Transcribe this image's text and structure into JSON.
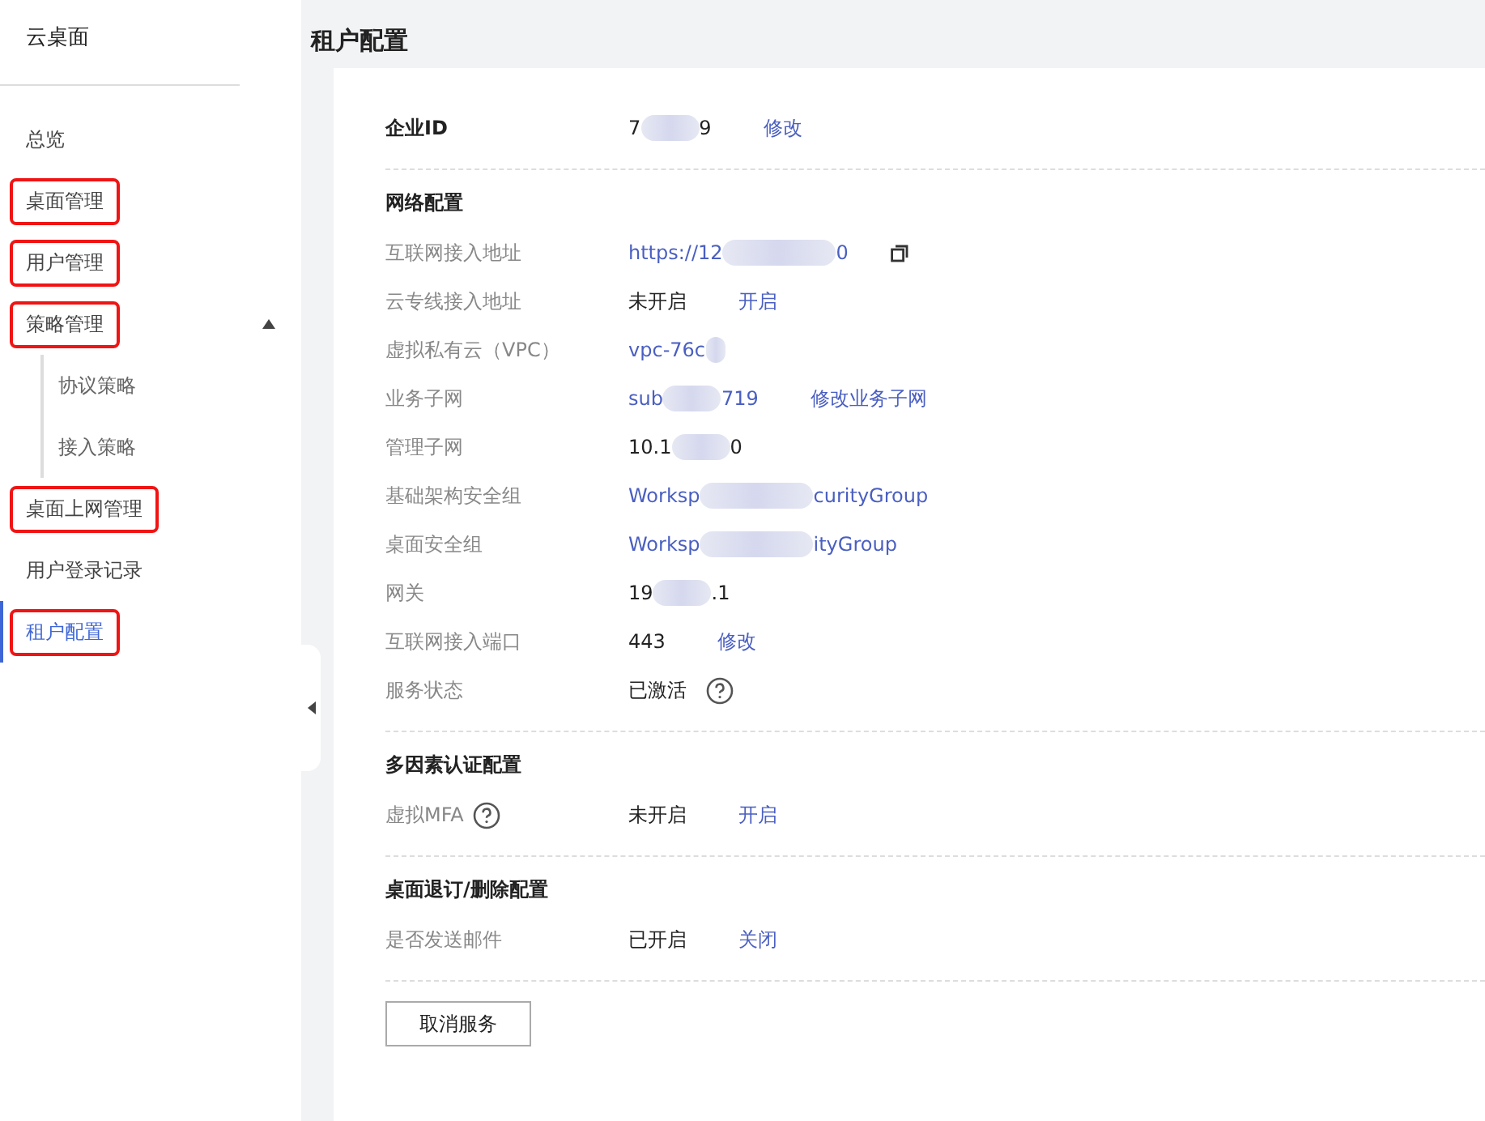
{
  "sidebar": {
    "title": "云桌面",
    "items": [
      {
        "label": "总览",
        "selected": false,
        "highlighted": false
      },
      {
        "label": "桌面管理",
        "selected": false,
        "highlighted": true
      },
      {
        "label": "用户管理",
        "selected": false,
        "highlighted": true
      },
      {
        "label": "策略管理",
        "selected": false,
        "highlighted": true,
        "expanded": true,
        "children": [
          {
            "label": "协议策略",
            "selected": false,
            "highlighted": false
          },
          {
            "label": "接入策略",
            "selected": false,
            "highlighted": false
          }
        ]
      },
      {
        "label": "桌面上网管理",
        "selected": false,
        "highlighted": true
      },
      {
        "label": "用户登录记录",
        "selected": false,
        "highlighted": false
      },
      {
        "label": "租户配置",
        "selected": true,
        "highlighted": true
      }
    ]
  },
  "page": {
    "title": "租户配置"
  },
  "sections": [
    {
      "rows": [
        {
          "label": "企业ID",
          "bold": true,
          "value": [
            {
              "kind": "text",
              "text": "7"
            },
            {
              "kind": "blur"
            },
            {
              "kind": "text",
              "text": "9"
            }
          ],
          "action": "修改"
        }
      ]
    },
    {
      "title": "网络配置",
      "rows": [
        {
          "label": "互联网接入地址",
          "value": [
            {
              "kind": "link",
              "text": "https://12"
            },
            {
              "kind": "wideblur"
            },
            {
              "kind": "link",
              "text": "0"
            },
            {
              "kind": "copy"
            }
          ]
        },
        {
          "label": "云专线接入地址",
          "value": [
            {
              "kind": "text",
              "text": "未开启"
            }
          ],
          "action": "开启"
        },
        {
          "label": "虚拟私有云（VPC）",
          "value": [
            {
              "kind": "link",
              "text": "vpc-76c"
            },
            {
              "kind": "smallblur"
            }
          ]
        },
        {
          "label": "业务子网",
          "value": [
            {
              "kind": "link",
              "text": "sub"
            },
            {
              "kind": "blur"
            },
            {
              "kind": "link",
              "text": "719"
            }
          ],
          "action": "修改业务子网"
        },
        {
          "label": "管理子网",
          "value": [
            {
              "kind": "text",
              "text": "10.1"
            },
            {
              "kind": "blur"
            },
            {
              "kind": "text",
              "text": "0"
            }
          ]
        },
        {
          "label": "基础架构安全组",
          "value": [
            {
              "kind": "link",
              "text": "Worksp"
            },
            {
              "kind": "wideblur"
            },
            {
              "kind": "link",
              "text": "curityGroup"
            }
          ]
        },
        {
          "label": "桌面安全组",
          "value": [
            {
              "kind": "link",
              "text": "Worksp"
            },
            {
              "kind": "wideblur"
            },
            {
              "kind": "link",
              "text": "ityGroup"
            }
          ]
        },
        {
          "label": "网关",
          "value": [
            {
              "kind": "text",
              "text": "19"
            },
            {
              "kind": "blur"
            },
            {
              "kind": "text",
              "text": ".1"
            }
          ]
        },
        {
          "label": "互联网接入端口",
          "value": [
            {
              "kind": "text",
              "text": "443"
            }
          ],
          "action": "修改"
        },
        {
          "label": "服务状态",
          "value": [
            {
              "kind": "text",
              "text": "已激活"
            },
            {
              "kind": "help"
            }
          ]
        }
      ]
    },
    {
      "title": "多因素认证配置",
      "rows": [
        {
          "label": "虚拟MFA",
          "label_help": true,
          "value": [
            {
              "kind": "text",
              "text": "未开启"
            }
          ],
          "action": "开启"
        }
      ]
    },
    {
      "title": "桌面退订/删除配置",
      "rows": [
        {
          "label": "是否发送邮件",
          "value": [
            {
              "kind": "text",
              "text": "已开启"
            }
          ],
          "action": "关闭"
        }
      ]
    }
  ],
  "footer_button": "取消服务"
}
